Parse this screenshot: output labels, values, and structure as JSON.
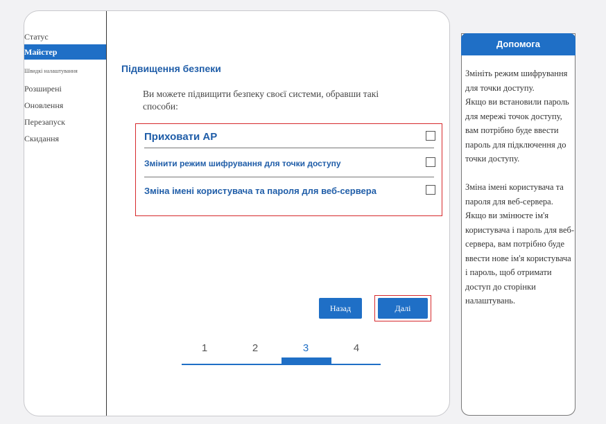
{
  "sidebar": {
    "items": [
      {
        "label": "Статус"
      },
      {
        "label": "Майстер"
      },
      {
        "label": "Швидкі налаштування"
      },
      {
        "label": "Розширені"
      },
      {
        "label": "Оновлення"
      },
      {
        "label": "Перезапуск"
      },
      {
        "label": "Скидання"
      }
    ],
    "active_index": 1
  },
  "main": {
    "section_title": "Підвищення безпеки",
    "intro": "Ви можете підвищити безпеку своєї системи, обравши такі способи:",
    "options": [
      {
        "label": "Приховати AP",
        "checked": false
      },
      {
        "label": "Змінити режим шифрування для точки доступу",
        "checked": false
      },
      {
        "label": "Зміна імені користувача та пароля для веб-сервера",
        "checked": false
      }
    ],
    "buttons": {
      "back": "Назад",
      "next": "Далі"
    },
    "steps": [
      "1",
      "2",
      "3",
      "4"
    ],
    "current_step": 3
  },
  "help": {
    "title": "Допомога",
    "paragraphs": [
      "Змініть режим шифрування для точки доступу.",
      "Якщо ви встановили пароль для мережі точок доступу, вам потрібно буде ввести пароль для підключення до точки доступу.",
      "Зміна імені користувача та пароля для веб-сервера.",
      "Якщо ви змінюєте ім'я користувача і пароль для веб-сервера, вам потрібно буде ввести нове ім'я користувача і пароль, щоб отримати доступ до сторінки налаштувань."
    ]
  },
  "colors": {
    "accent": "#1f6fc6",
    "title_blue": "#1f5da8",
    "highlight_red": "#d6282b"
  }
}
